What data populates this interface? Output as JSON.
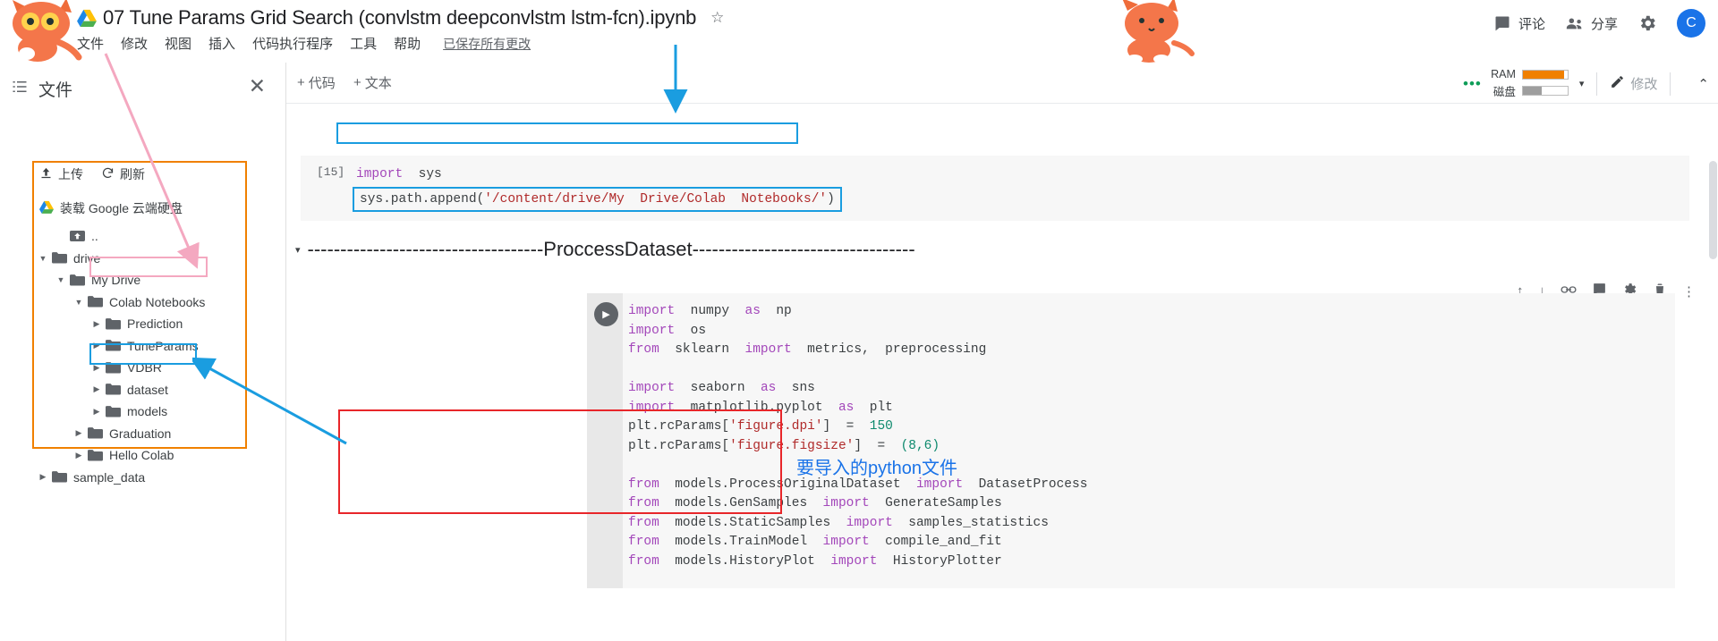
{
  "window": {
    "doc_title": "07 Tune Params Grid Search (convlstm deepconvlstm lstm-fcn).ipynb",
    "star_glyph": "☆"
  },
  "menu": {
    "items": [
      "文件",
      "修改",
      "视图",
      "插入",
      "代码执行程序",
      "工具",
      "帮助"
    ],
    "saved_status": "已保存所有更改"
  },
  "topbar_right": {
    "comment_label": "评论",
    "share_label": "分享",
    "avatar_letter": "C"
  },
  "files_panel": {
    "title": "文件",
    "close_glyph": "✕",
    "upload_label": "上传",
    "refresh_label": "刷新",
    "mount_drive_label": "装载 Google 云端硬盘",
    "tree": [
      {
        "label": "..",
        "indent": 1,
        "arrow": "none",
        "icon": "folder-up-icon"
      },
      {
        "label": "drive",
        "indent": 0,
        "arrow": "open",
        "icon": "folder-icon"
      },
      {
        "label": "My Drive",
        "indent": 1,
        "arrow": "open",
        "icon": "folder-icon"
      },
      {
        "label": "Colab Notebooks",
        "indent": 2,
        "arrow": "open",
        "icon": "folder-icon"
      },
      {
        "label": "Prediction",
        "indent": 3,
        "arrow": "closed",
        "icon": "folder-icon"
      },
      {
        "label": "TuneParams",
        "indent": 3,
        "arrow": "closed",
        "icon": "folder-icon"
      },
      {
        "label": "VDBR",
        "indent": 3,
        "arrow": "closed",
        "icon": "folder-icon"
      },
      {
        "label": "dataset",
        "indent": 3,
        "arrow": "closed",
        "icon": "folder-icon"
      },
      {
        "label": "models",
        "indent": 3,
        "arrow": "closed",
        "icon": "folder-icon"
      },
      {
        "label": "Graduation",
        "indent": 2,
        "arrow": "closed",
        "icon": "folder-icon"
      },
      {
        "label": "Hello Colab",
        "indent": 2,
        "arrow": "closed",
        "icon": "folder-icon"
      },
      {
        "label": "sample_data",
        "indent": 0,
        "arrow": "closed",
        "icon": "folder-icon"
      }
    ]
  },
  "notebook_toolbar": {
    "add_code_label": "代码",
    "add_text_label": "文本",
    "ram_label": "RAM",
    "disk_label": "磁盘",
    "ram_fill_pct": 92,
    "disk_fill_pct": 42,
    "ram_color": "#f08000",
    "disk_color": "#9e9e9e",
    "edit_label": "修改",
    "collapse_glyph": "⌃",
    "caret_glyph": "▾"
  },
  "cell_one": {
    "exec_count": "[15]",
    "line1_kw": "import",
    "line1_rest": "  sys",
    "line2_obj": "sys.path.append",
    "line2_open": "(",
    "line2_str": "'/content/drive/My  Drive/Colab  Notebooks/'",
    "line2_close": ")"
  },
  "markdown_cell": {
    "caret": "▾",
    "text": "------------------------------------ProccessDataset----------------------------------"
  },
  "cell_two": {
    "run_glyph": "▶",
    "lines": [
      [
        {
          "t": "import",
          "c": "kw"
        },
        {
          "t": "  numpy  ",
          "c": "plain"
        },
        {
          "t": "as",
          "c": "kw"
        },
        {
          "t": "  np",
          "c": "plain"
        }
      ],
      [
        {
          "t": "import",
          "c": "kw"
        },
        {
          "t": "  os",
          "c": "plain"
        }
      ],
      [
        {
          "t": "from",
          "c": "kw"
        },
        {
          "t": "  sklearn  ",
          "c": "plain"
        },
        {
          "t": "import",
          "c": "kw"
        },
        {
          "t": "  metrics,  preprocessing",
          "c": "plain"
        }
      ],
      [
        {
          "t": " ",
          "c": "plain"
        }
      ],
      [
        {
          "t": "import",
          "c": "kw"
        },
        {
          "t": "  seaborn  ",
          "c": "plain"
        },
        {
          "t": "as",
          "c": "kw"
        },
        {
          "t": "  sns",
          "c": "plain"
        }
      ],
      [
        {
          "t": "import",
          "c": "kw"
        },
        {
          "t": "  matplotlib.pyplot  ",
          "c": "plain"
        },
        {
          "t": "as",
          "c": "kw"
        },
        {
          "t": "  plt",
          "c": "plain"
        }
      ],
      [
        {
          "t": "plt.rcParams[",
          "c": "plain"
        },
        {
          "t": "'figure.dpi'",
          "c": "str"
        },
        {
          "t": "]  =  ",
          "c": "plain"
        },
        {
          "t": "150",
          "c": "num"
        }
      ],
      [
        {
          "t": "plt.rcParams[",
          "c": "plain"
        },
        {
          "t": "'figure.figsize'",
          "c": "str"
        },
        {
          "t": "]  =  ",
          "c": "plain"
        },
        {
          "t": "(8,6)",
          "c": "num"
        }
      ],
      [
        {
          "t": " ",
          "c": "plain"
        }
      ],
      [
        {
          "t": "from",
          "c": "kw"
        },
        {
          "t": "  models.ProcessOriginalDataset  ",
          "c": "plain"
        },
        {
          "t": "import",
          "c": "kw"
        },
        {
          "t": "  DatasetProcess",
          "c": "plain"
        }
      ],
      [
        {
          "t": "from",
          "c": "kw"
        },
        {
          "t": "  models.GenSamples  ",
          "c": "plain"
        },
        {
          "t": "import",
          "c": "kw"
        },
        {
          "t": "  GenerateSamples",
          "c": "plain"
        }
      ],
      [
        {
          "t": "from",
          "c": "kw"
        },
        {
          "t": "  models.StaticSamples  ",
          "c": "plain"
        },
        {
          "t": "import",
          "c": "kw"
        },
        {
          "t": "  samples_statistics",
          "c": "plain"
        }
      ],
      [
        {
          "t": "from",
          "c": "kw"
        },
        {
          "t": "  models.TrainModel  ",
          "c": "plain"
        },
        {
          "t": "import",
          "c": "kw"
        },
        {
          "t": "  compile_and_fit",
          "c": "plain"
        }
      ],
      [
        {
          "t": "from",
          "c": "kw"
        },
        {
          "t": "  models.HistoryPlot  ",
          "c": "plain"
        },
        {
          "t": "import",
          "c": "kw"
        },
        {
          "t": "  HistoryPlotter",
          "c": "plain"
        }
      ]
    ]
  },
  "cell_toolbar": {
    "move_up": "↑",
    "move_down": "↓",
    "link": "🔗",
    "comment": "💬",
    "settings": "⚙",
    "delete": "🗑",
    "more": "⋮"
  },
  "annotations": {
    "python_files_note": "要导入的python文件",
    "colors": {
      "orange_box": "#f08000",
      "pink_box": "#f4a8c0",
      "blue_box": "#1a9de0",
      "red_box": "#e8262a",
      "note_text": "#1a73e8"
    }
  }
}
